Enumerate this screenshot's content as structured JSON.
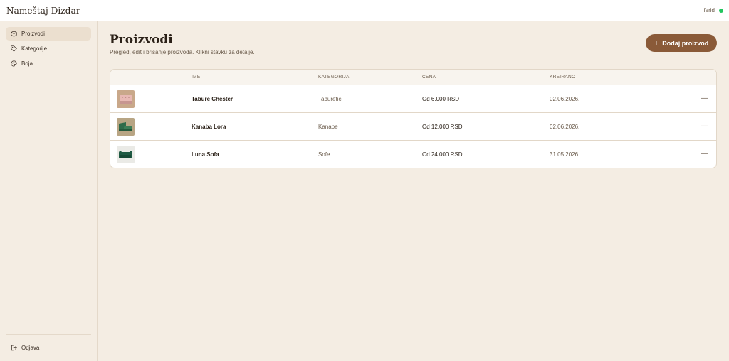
{
  "app": {
    "brand": "Nameštaj Dizdar"
  },
  "user": {
    "name": "ferid",
    "status_color": "#22c55e"
  },
  "sidebar": {
    "items": [
      {
        "label": "Proizvodi",
        "icon": "box-icon",
        "active": true
      },
      {
        "label": "Kategorije",
        "icon": "tag-icon",
        "active": false
      },
      {
        "label": "Boja",
        "icon": "palette-icon",
        "active": false
      }
    ],
    "logout_label": "Odjava"
  },
  "page": {
    "title": "Proizvodi",
    "subtitle": "Pregled, edit i brisanje proizvoda. Klikni stavku za detalje.",
    "add_button_label": "Dodaj proizvod"
  },
  "table": {
    "columns": [
      "IME",
      "KATEGORIJA",
      "CENA",
      "KREIRANO"
    ],
    "rows": [
      {
        "name": "Tabure Chester",
        "category": "Taburetići",
        "price": "Od 6.000 RSD",
        "created": "02.06.2026.",
        "action": "—",
        "thumb": "pink-ottoman-image"
      },
      {
        "name": "Kanaba Lora",
        "category": "Kanabe",
        "price": "Od 12.000 RSD",
        "created": "02.06.2026.",
        "action": "—",
        "thumb": "green-sofa-image"
      },
      {
        "name": "Luna Sofa",
        "category": "Sofe",
        "price": "Od 24.000 RSD",
        "created": "31.05.2026.",
        "action": "—",
        "thumb": "green-velvet-sofa-image"
      }
    ]
  },
  "colors": {
    "accent": "#8a5a38",
    "background": "#f4ede3",
    "active_nav": "#ebdfcf"
  }
}
